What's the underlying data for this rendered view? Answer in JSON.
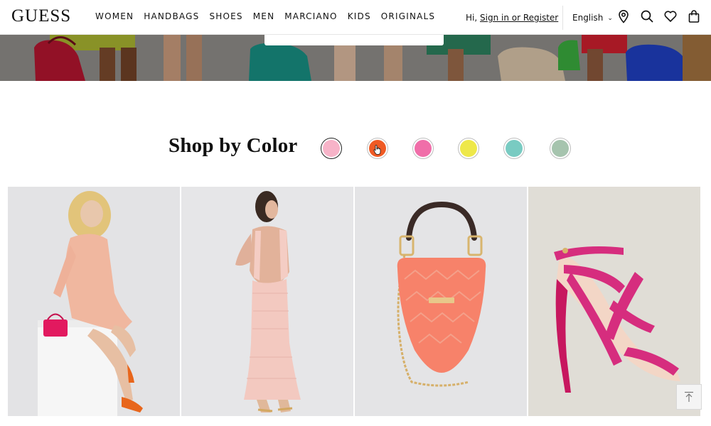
{
  "brand": {
    "logo": "GUESS"
  },
  "nav": {
    "items": [
      {
        "label": "WOMEN"
      },
      {
        "label": "HANDBAGS"
      },
      {
        "label": "SHOES"
      },
      {
        "label": "MEN"
      },
      {
        "label": "MARCIANO"
      },
      {
        "label": "KIDS"
      },
      {
        "label": "ORIGINALS"
      }
    ]
  },
  "account": {
    "greeting": "Hi,",
    "signin_link": "Sign in or Register",
    "language": "English"
  },
  "header_icons": [
    "location-pin-icon",
    "search-icon",
    "heart-icon",
    "shopping-bag-icon"
  ],
  "shop_by_color": {
    "title": "Shop by Color",
    "swatches": [
      {
        "name": "light-pink",
        "color": "#f7b3c8",
        "selected": true
      },
      {
        "name": "orange",
        "color": "#ef5a24",
        "selected": false
      },
      {
        "name": "pink",
        "color": "#f06ea9",
        "selected": false
      },
      {
        "name": "yellow",
        "color": "#eee84a",
        "selected": false
      },
      {
        "name": "teal",
        "color": "#79cbc2",
        "selected": false
      },
      {
        "name": "sage",
        "color": "#a6c4ae",
        "selected": false
      }
    ]
  },
  "products": [
    {
      "name": "satin-wrap-dress",
      "color": "#f1b39b"
    },
    {
      "name": "lace-maxi-dress",
      "color": "#f2c4bc"
    },
    {
      "name": "quilted-hobo-bag",
      "color": "#f7826a"
    },
    {
      "name": "strappy-heel-sandal",
      "color": "#d62d7e"
    }
  ],
  "colors": {
    "text": "#111111",
    "header_border": "#e6e6e6"
  }
}
